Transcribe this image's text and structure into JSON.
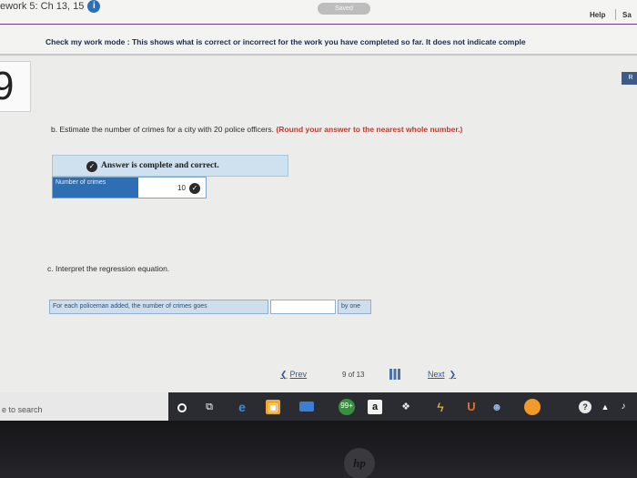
{
  "header": {
    "assignment_title": "ework 5: Ch 13, 15",
    "info_icon": "i",
    "saved_label": "Saved",
    "help_label": "Help",
    "save_label": "Sa"
  },
  "banner": {
    "mode_text": "Check my work mode : This shows what is correct or incorrect for the work you have completed so far. It does not indicate comple"
  },
  "question": {
    "number": "9",
    "report_label": "R",
    "part_b": {
      "prompt": "b. Estimate the number of crimes for a city with 20 police officers.",
      "instruction": "(Round your answer to the nearest whole number.)",
      "status_text": "Answer is complete and correct.",
      "row_label": "Number of crimes",
      "row_value": "10"
    },
    "part_c": {
      "prompt": "c. Interpret the regression equation.",
      "sentence_prefix": "For each policeman added, the number of crimes goes",
      "input_value": "",
      "sentence_suffix": "by one"
    }
  },
  "pager": {
    "prev_label": "Prev",
    "page_current": "9",
    "page_of": "of",
    "page_total": "13",
    "next_label": "Next"
  },
  "taskbar": {
    "search_text": "e to search",
    "chrome_badge": "99+",
    "amazon_label": "a",
    "help_glyph": "?",
    "icons": [
      "cortana-icon",
      "task-view-icon",
      "edge-icon",
      "store-icon",
      "mail-icon",
      "chrome-icon",
      "amazon-icon",
      "dropbox-icon",
      "flash-icon",
      "office-icon",
      "people-icon",
      "overwatch-icon",
      "help-icon",
      "tray-up-icon",
      "volume-icon"
    ]
  },
  "bezel": {
    "logo_text": "hp"
  },
  "colors": {
    "accent_purple": "#6a3d8f",
    "link_blue": "#2c5aa0",
    "instruction_red": "#c0392b",
    "answer_banner_bg": "#cfe0ee"
  }
}
